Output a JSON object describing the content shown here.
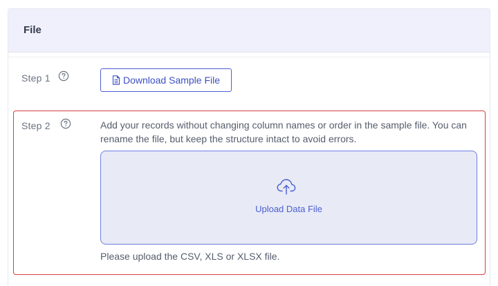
{
  "section": {
    "title": "File"
  },
  "step1": {
    "label": "Step 1",
    "download_button_label": "Download Sample File"
  },
  "step2": {
    "label": "Step 2",
    "description": "Add your records without changing column names or order in the sample file. You can rename the file, but keep the structure intact to avoid errors.",
    "upload_label": "Upload Data File",
    "hint": "Please upload the CSV, XLS or XLSX file."
  },
  "icons": {
    "help": "help-circle-icon",
    "document": "document-icon",
    "upload": "cloud-upload-icon"
  },
  "colors": {
    "accent": "#4c5fd5",
    "header_bg": "#f0f0fc",
    "dropzone_bg": "#e8eaf6",
    "error_border": "#d63c3c"
  }
}
